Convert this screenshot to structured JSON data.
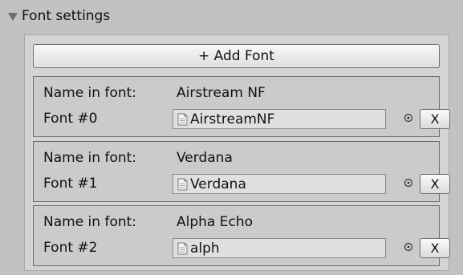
{
  "section": {
    "title": "Font settings",
    "foldout_icon": "triangle-down-icon"
  },
  "add_button": {
    "label": "+ Add Font"
  },
  "fonts": [
    {
      "name_label": "Name in font:",
      "name_value": "Airstream NF",
      "index_label": "Font #0",
      "asset": "AirstreamNF",
      "asset_icon": "document-icon",
      "remove_label": "X"
    },
    {
      "name_label": "Name in font:",
      "name_value": "Verdana",
      "index_label": "Font #1",
      "asset": "Verdana",
      "asset_icon": "document-icon",
      "remove_label": "X"
    },
    {
      "name_label": "Name in font:",
      "name_value": "Alpha Echo",
      "index_label": "Font #2",
      "asset": "alph",
      "asset_icon": "document-icon",
      "remove_label": "X"
    }
  ],
  "colors": {
    "background": "#c2c2c2",
    "panel": "#d4d4d4",
    "field": "#e0e0e0"
  }
}
